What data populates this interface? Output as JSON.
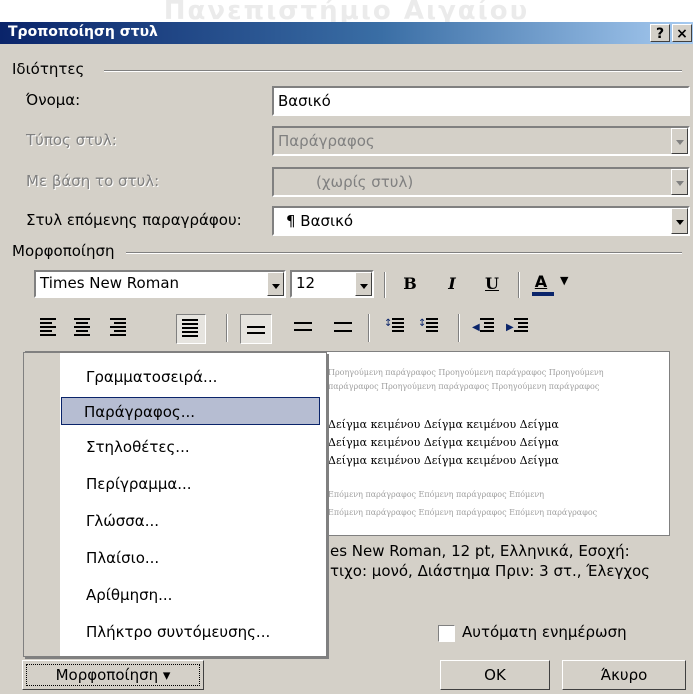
{
  "watermark": "Πανεπιστήμιο Αιγαίου",
  "window": {
    "title": "Τροποποίηση στυλ",
    "help_label": "?",
    "close_label": "×"
  },
  "properties": {
    "group_label": "Ιδιότητες",
    "name_label": "Όνομα:",
    "name_value": "Βασικό",
    "type_label": "Τύπος στυλ:",
    "type_value": "Παράγραφος",
    "based_on_label": "Με βάση το στυλ:",
    "based_on_value": "(χωρίς στυλ)",
    "next_label": "Στυλ επόμενης παραγράφου:",
    "next_value": "¶ Βασικό"
  },
  "formatting": {
    "group_label": "Μορφοποίηση",
    "font": "Times New Roman",
    "size": "12",
    "bold": "B",
    "italic": "I",
    "underline": "U",
    "font_color": "A"
  },
  "preview": {
    "prev_lines": [
      "Προηγούμενη παράγραφος Προηγούμενη παράγραφος Προηγούμενη",
      "παράγραφος Προηγούμενη παράγραφος Προηγούμενη παράγραφος"
    ],
    "sample_lines": [
      "Δείγμα κειμένου Δείγμα κειμένου Δείγμα",
      "Δείγμα κειμένου Δείγμα κειμένου Δείγμα",
      "Δείγμα κειμένου Δείγμα κειμένου Δείγμα"
    ],
    "next_lines": [
      "Επόμενη παράγραφος Επόμενη παράγραφος Επόμενη",
      "Επόμενη παράγραφος Επόμενη παράγραφος Επόμενη παράγραφος"
    ]
  },
  "description": {
    "line1": "es New Roman, 12 pt, Ελληνικά, Εσοχή:",
    "line2": "τιχο:  μονό, Διάστημα Πριν:  3 στ., Έλεγχος"
  },
  "menu": {
    "items": [
      "Γραμματοσειρά...",
      "Παράγραφος...",
      "Στηλοθέτες...",
      "Περίγραμμα...",
      "Γλώσσα...",
      "Πλαίσιο...",
      "Αρίθμηση...",
      "Πλήκτρο συντόμευσης..."
    ],
    "selected": "Παράγραφος..."
  },
  "footer": {
    "auto_update_label": "Αυτόματη ενημέρωση",
    "format_button": "Μορφοποίηση ▾",
    "ok_button": "OK",
    "cancel_button": "Άκυρο"
  }
}
